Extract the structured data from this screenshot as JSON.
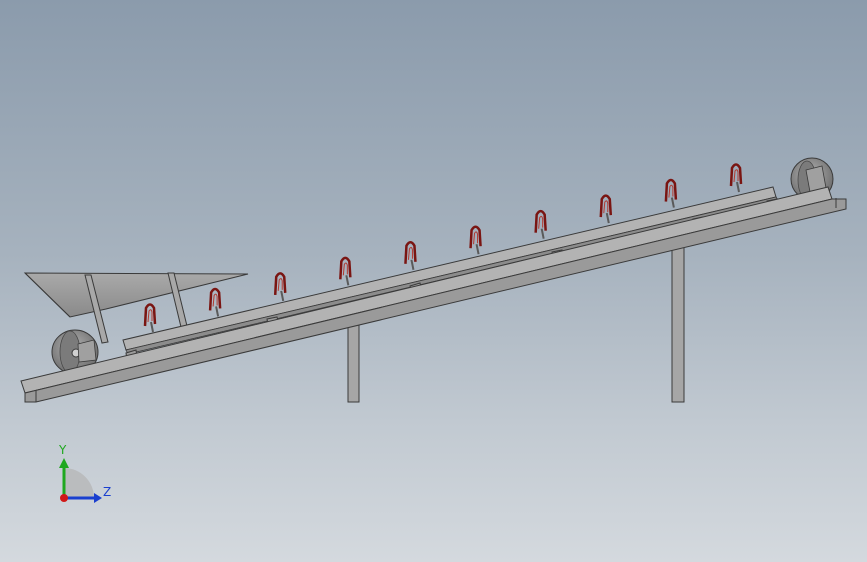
{
  "viewport": {
    "background_top": "#8b9bac",
    "background_bottom": "#d4d9de"
  },
  "model": {
    "frame_color": "#a3a3a3",
    "frame_outline": "#3a3a3a",
    "hopper_color": "#9a9a9a",
    "wheel_color": "#8e8e8e",
    "cleat_color": "#7a1512",
    "cleat_count": 10
  },
  "triad": {
    "y_label": "Y",
    "z_label": "Z",
    "y_color": "#1fa81f",
    "z_color": "#1a3fcf",
    "x_color": "#d01818"
  }
}
